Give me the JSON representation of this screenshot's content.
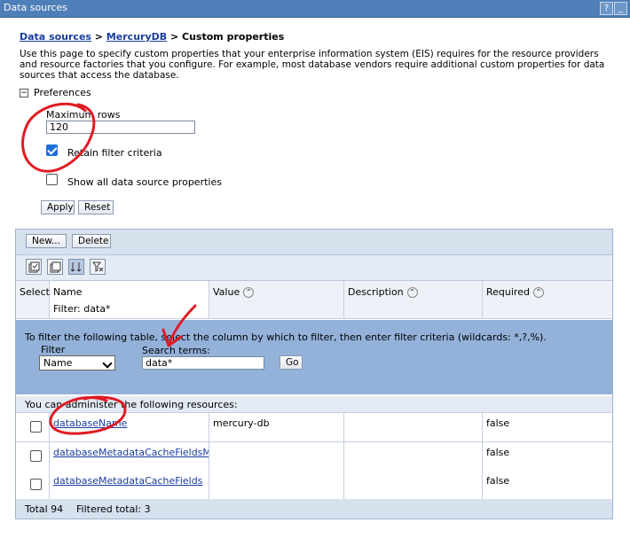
{
  "window": {
    "title": "Data sources",
    "help": "?",
    "minimize": "_"
  },
  "breadcrumb": {
    "link1": "Data sources",
    "sep1": " > ",
    "link2": "MercuryDB",
    "sep2": " > ",
    "current": "Custom properties"
  },
  "description": "Use this page to specify custom properties that your enterprise information system (EIS) requires for the resource providers and resource factories that you configure. For example, most database vendors require additional custom properties for data sources that access the database.",
  "preferences": {
    "toggle": "−",
    "label": "Preferences",
    "max_rows_label": "Maximum rows",
    "max_rows_value": "120",
    "retain_filter_label": "Retain filter criteria",
    "retain_filter_checked": true,
    "show_all_label": "Show all data source properties",
    "show_all_checked": false,
    "apply": "Apply",
    "reset": "Reset"
  },
  "toolbar": {
    "new": "New...",
    "delete": "Delete"
  },
  "icons": [
    "select-all-icon",
    "deselect-all-icon",
    "show-filter-icon",
    "clear-filter-icon"
  ],
  "table": {
    "headers": {
      "select": "Select",
      "name": "Name",
      "value": "Value",
      "description": "Description",
      "required": "Required"
    },
    "filter_note": "Filter: data*",
    "filter_instructions": "To filter the following table, select the column by which to filter, then enter filter criteria (wildcards: *,?,%).",
    "filter_label": "Filter",
    "filter_select": "Name",
    "search_label": "Search terms:",
    "search_value": "data*",
    "go": "Go",
    "resources_note": "You can administer the following resources:",
    "rows": [
      {
        "name": "databaseName",
        "value": "mercury-db",
        "description": "",
        "required": "false"
      },
      {
        "name": "databaseMetadataCacheFieldsMiB",
        "value": "",
        "description": "",
        "required": "false"
      },
      {
        "name": "databaseMetadataCacheFields",
        "value": "",
        "description": "",
        "required": "false"
      }
    ],
    "total": "Total 94",
    "filtered_total": "Filtered total: 3"
  },
  "colors": {
    "titlebar": "#4f7fb8",
    "filter_bg": "#93b1d9",
    "annotation": "#e01b24",
    "link": "#1a3d9e"
  }
}
